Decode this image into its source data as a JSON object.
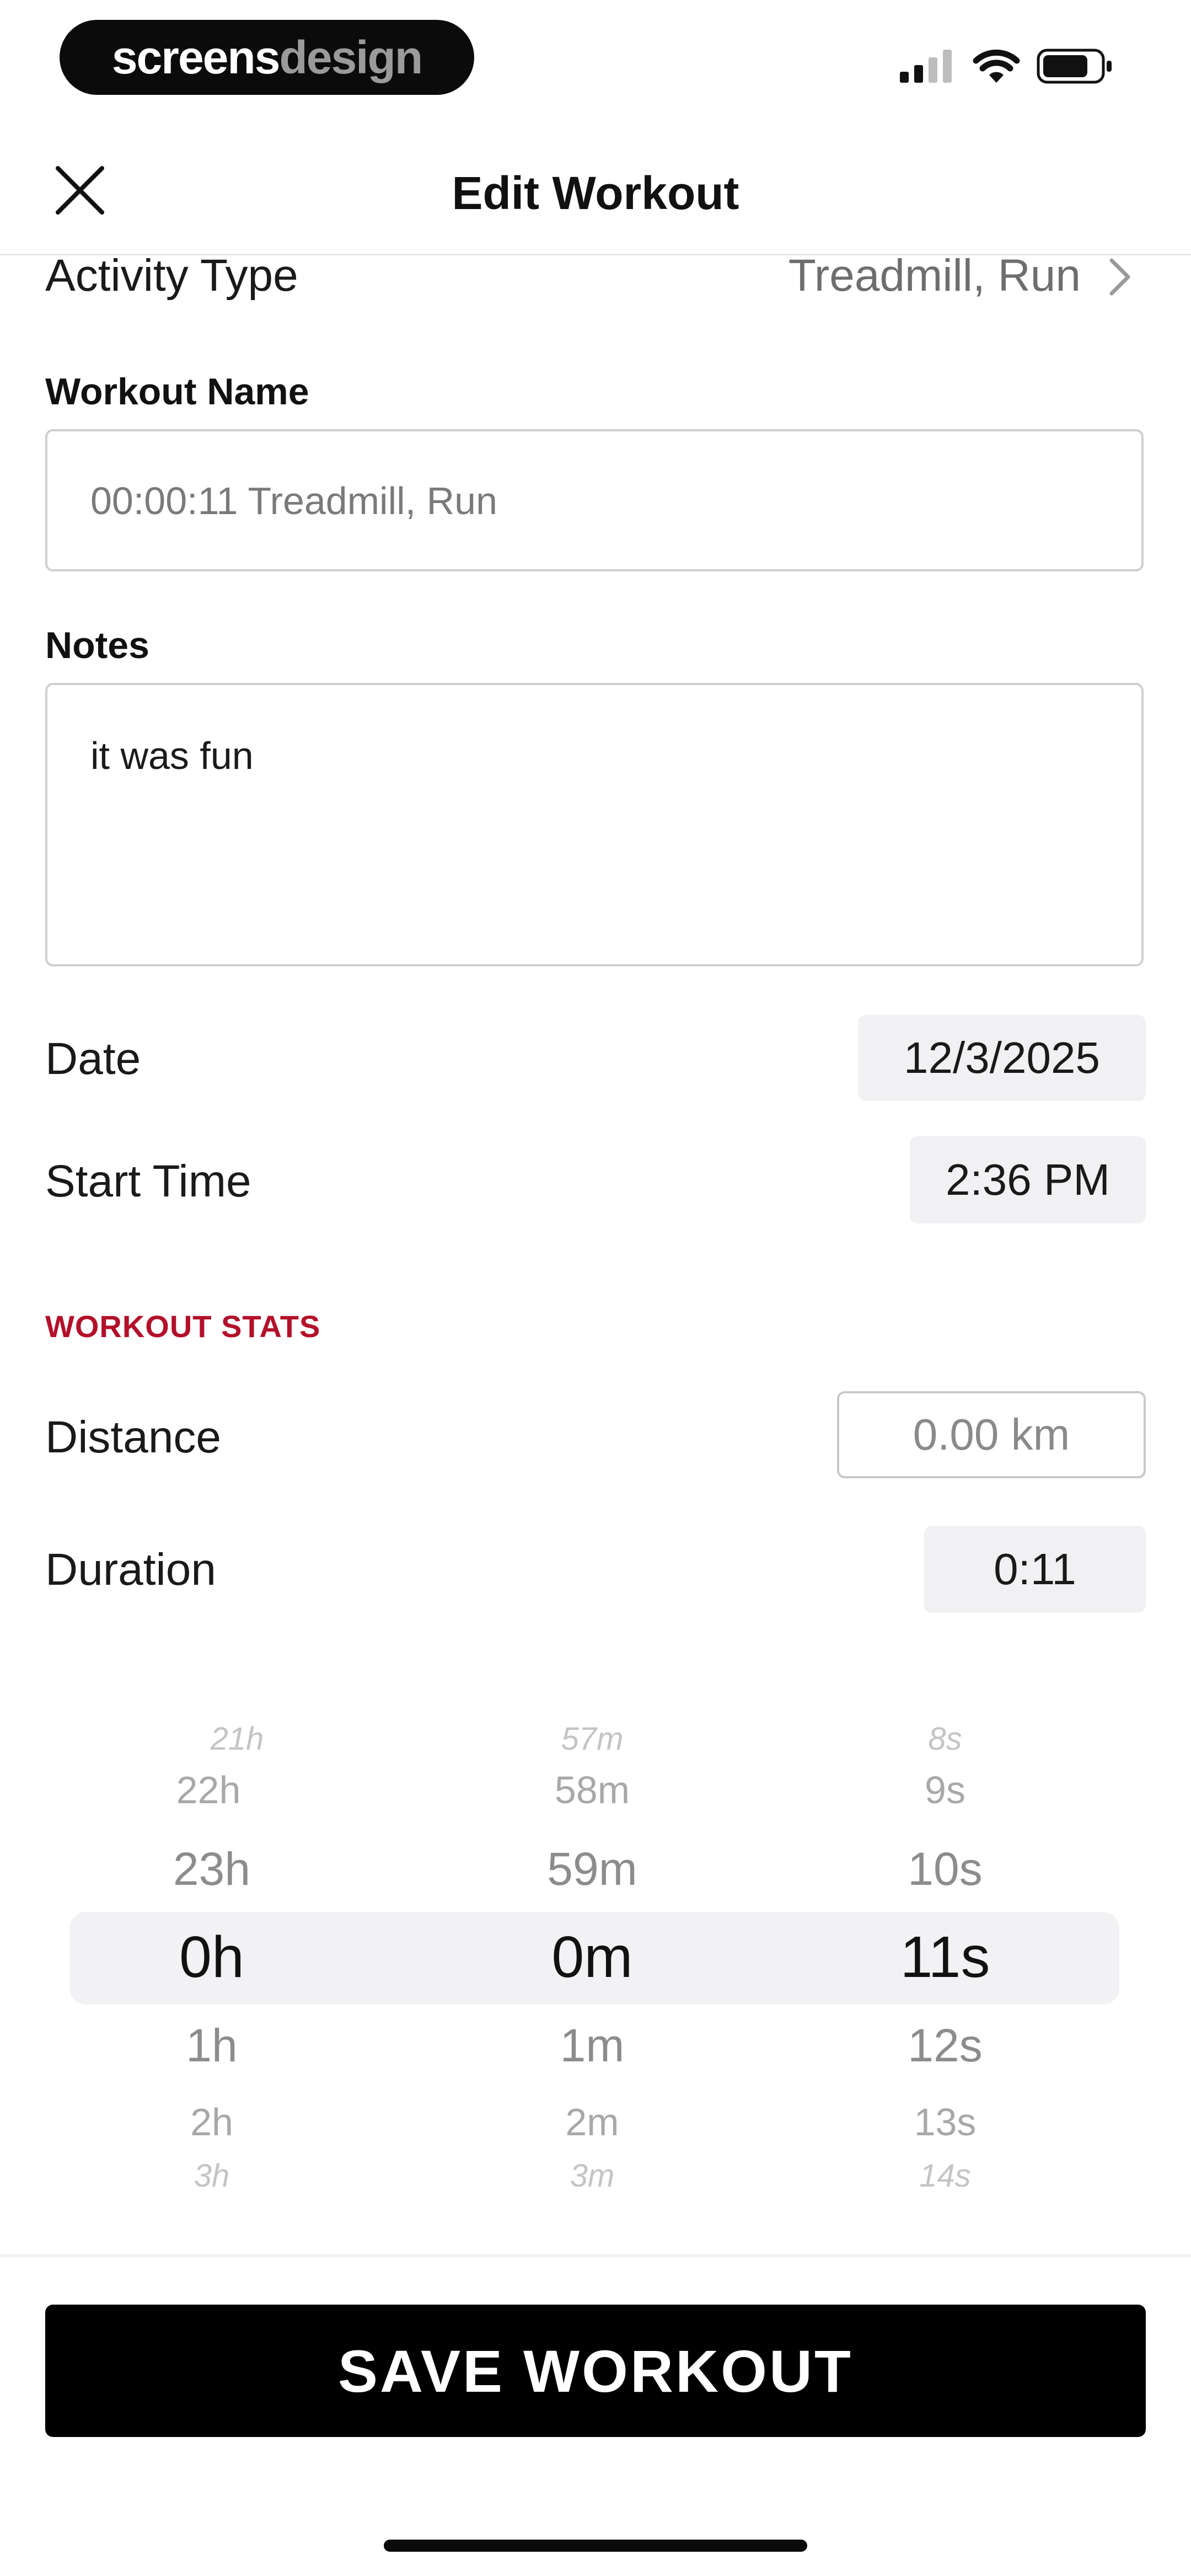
{
  "status_bar": {
    "brand_part1": "screens",
    "brand_part2": "design"
  },
  "header": {
    "title": "Edit Workout"
  },
  "activity": {
    "label": "Activity Type",
    "value": "Treadmill, Run"
  },
  "workout_name": {
    "label": "Workout Name",
    "value": "00:00:11 Treadmill, Run"
  },
  "notes": {
    "label": "Notes",
    "value": "it was fun"
  },
  "date": {
    "label": "Date",
    "value": "12/3/2025"
  },
  "start_time": {
    "label": "Start Time",
    "value": "2:36 PM"
  },
  "stats": {
    "heading": "WORKOUT STATS",
    "distance_label": "Distance",
    "distance_placeholder": "0.00 km",
    "duration_label": "Duration",
    "duration_value": "0:11"
  },
  "picker": {
    "hours": [
      "21h",
      "22h",
      "23h",
      "0h",
      "1h",
      "2h",
      "3h"
    ],
    "minutes": [
      "57m",
      "58m",
      "59m",
      "0m",
      "1m",
      "2m",
      "3m"
    ],
    "seconds": [
      "8s",
      "9s",
      "10s",
      "11s",
      "12s",
      "13s",
      "14s"
    ]
  },
  "footer": {
    "save_label": "SAVE WORKOUT"
  }
}
